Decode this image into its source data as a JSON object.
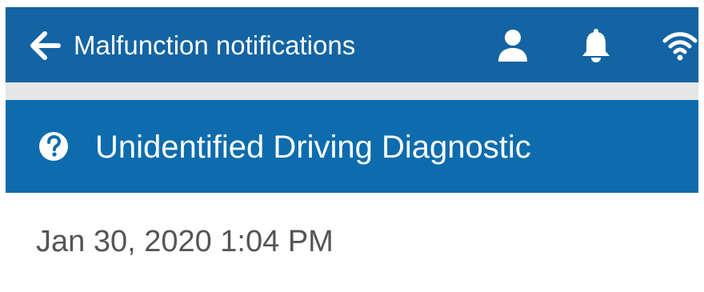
{
  "header": {
    "back_icon": "arrow-left-icon",
    "title": "Malfunction notifications",
    "actions": [
      {
        "icon": "user-icon"
      },
      {
        "icon": "bell-icon"
      },
      {
        "icon": "wifi-icon"
      }
    ]
  },
  "card": {
    "icon": "question-circle-icon",
    "title": "Unidentified Driving Diagnostic",
    "timestamp": "Jan 30, 2020 1:04 PM"
  },
  "colors": {
    "appbar": "#1364a3",
    "card_header": "#0d6cad",
    "header_text": "#ffffff",
    "body_text": "#555555",
    "spacer": "#e6e6e6"
  }
}
